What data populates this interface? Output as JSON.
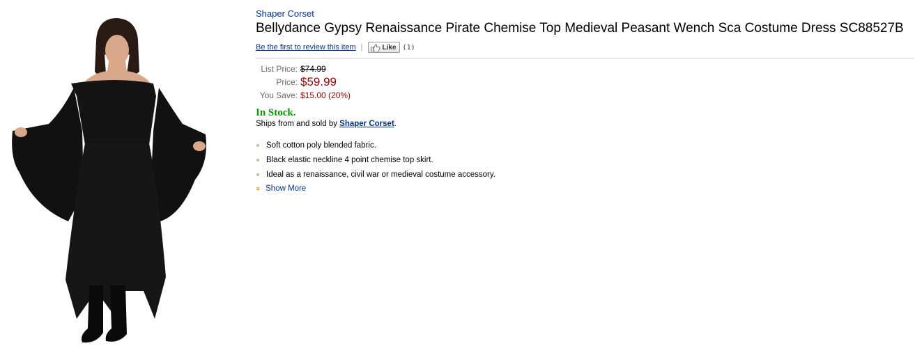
{
  "product": {
    "brand": "Shaper Corset",
    "title": "Bellydance Gypsy Renaissance Pirate Chemise Top Medieval Peasant Wench Sca Costume Dress SC88527B",
    "review_link": "Be the first to review this item",
    "separator": "|",
    "like_label": "Like",
    "like_count": "(1)"
  },
  "pricing": {
    "list_price_label": "List Price:",
    "list_price": "$74.99",
    "price_label": "Price:",
    "price": "$59.99",
    "you_save_label": "You Save:",
    "you_save": "$15.00 (20%)"
  },
  "availability": {
    "stock": "In Stock.",
    "ships_prefix": "Ships from and sold by ",
    "seller": "Shaper Corset",
    "ships_suffix": "."
  },
  "features": [
    "Soft cotton poly blended fabric.",
    "Black elastic neckline 4 point chemise top skirt.",
    "Ideal as a renaissance, civil war or medieval costume accessory."
  ],
  "show_more": "Show More",
  "colors": {
    "link": "#003399",
    "price": "#990000",
    "in_stock": "#009900"
  }
}
